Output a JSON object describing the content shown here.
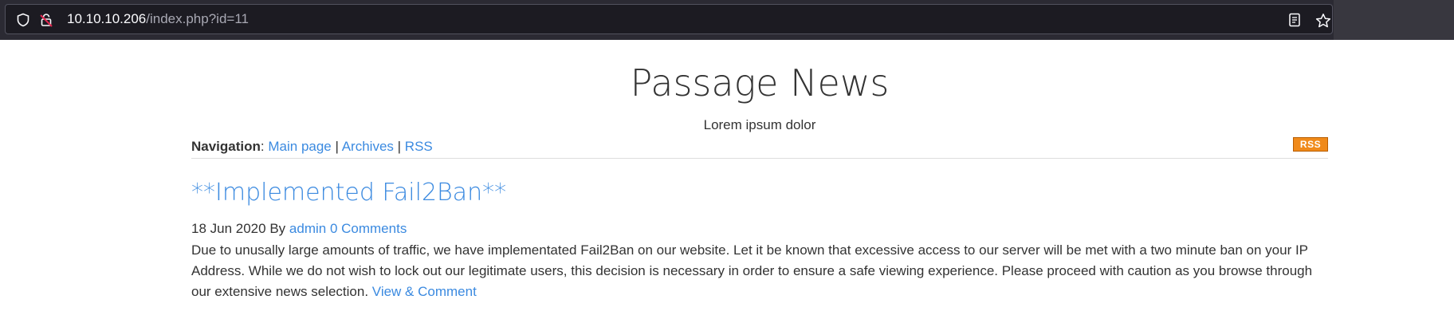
{
  "browser": {
    "url_host": "10.10.10.206",
    "url_path": "/index.php?id=11",
    "icons": [
      "shield-icon",
      "insecure-lock-icon",
      "reader-view-icon",
      "bookmark-star-icon"
    ]
  },
  "site": {
    "title": "Passage News",
    "subtitle": "Lorem ipsum dolor"
  },
  "nav": {
    "label": "Navigation",
    "colon": ":",
    "sep": "|",
    "items": [
      "Main page",
      "Archives",
      "RSS"
    ],
    "rss_badge": "RSS"
  },
  "post": {
    "title": "**Implemented Fail2Ban**",
    "date": "18 Jun 2020",
    "by": "By",
    "author": "admin",
    "comments": "0 Comments",
    "body": "Due to unusally large amounts of traffic, we have implementated Fail2Ban on our website. Let it be known that excessive access to our server will be met with a two minute ban on your IP Address. While we do not wish to lock out our legitimate users, this decision is necessary in order to ensure a safe viewing experience. Please proceed with caution as you browse through our extensive news selection.",
    "read_more": "View & Comment"
  },
  "colors": {
    "link": "#3b8ae0",
    "text": "#333333",
    "toolbar": "#2b2a33",
    "rss_badge": "#f08a1a"
  }
}
